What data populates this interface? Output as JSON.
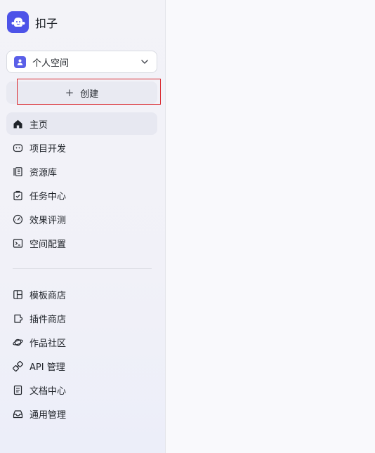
{
  "brand": {
    "name": "扣子"
  },
  "space_select": {
    "label": "个人空间"
  },
  "create_button": {
    "plus": "+",
    "label": "创建"
  },
  "nav_primary": [
    {
      "label": "主页",
      "icon": "home-icon",
      "active": true
    },
    {
      "label": "项目开发",
      "icon": "robot-icon"
    },
    {
      "label": "资源库",
      "icon": "library-icon"
    },
    {
      "label": "任务中心",
      "icon": "task-icon"
    },
    {
      "label": "效果评测",
      "icon": "gauge-icon"
    },
    {
      "label": "空间配置",
      "icon": "terminal-icon"
    }
  ],
  "nav_secondary": [
    {
      "label": "模板商店",
      "icon": "template-icon"
    },
    {
      "label": "插件商店",
      "icon": "plugin-icon"
    },
    {
      "label": "作品社区",
      "icon": "planet-icon"
    },
    {
      "label": "API 管理",
      "icon": "api-icon"
    },
    {
      "label": "文档中心",
      "icon": "document-icon"
    },
    {
      "label": "通用管理",
      "icon": "inbox-icon"
    }
  ],
  "colors": {
    "accent": "#4d53e8",
    "highlight_border": "#d9262c",
    "sidebar_bg": "#f3f3f8",
    "active_bg": "#e7e8f1"
  }
}
